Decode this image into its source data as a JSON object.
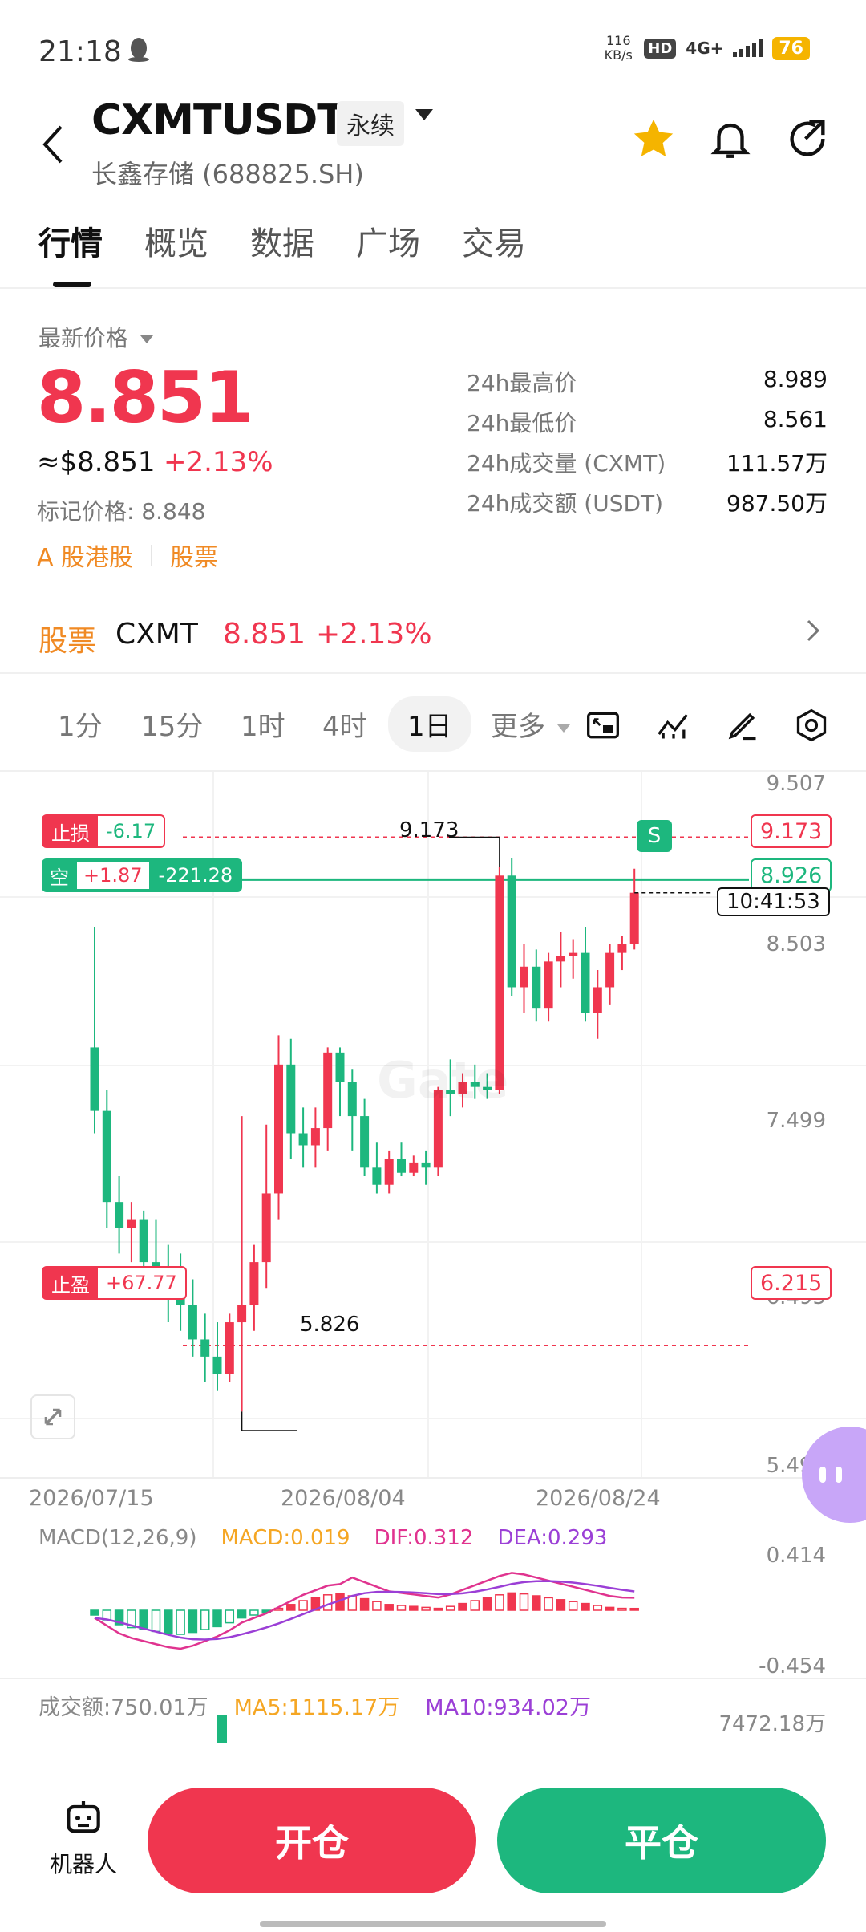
{
  "status": {
    "time": "21:18",
    "speed_top": "116",
    "speed_unit": "KB/s",
    "hd": "HD",
    "network": "4G+",
    "battery": "76"
  },
  "header": {
    "symbol": "CXMTUSDT",
    "contract": "永续",
    "subtitle": "长鑫存储 (688825.SH)"
  },
  "tabs": [
    "行情",
    "概览",
    "数据",
    "广场",
    "交易"
  ],
  "price": {
    "latest_label": "最新价格",
    "last": "8.851",
    "usd": "≈$8.851",
    "change_pct": "+2.13%",
    "mark_label": "标记价格: 8.848",
    "tag1": "A 股港股",
    "tag2": "股票",
    "stats": [
      {
        "label": "24h最高价",
        "value": "8.989"
      },
      {
        "label": "24h最低价",
        "value": "8.561"
      },
      {
        "label": "24h成交量 (CXMT)",
        "value": "111.57万"
      },
      {
        "label": "24h成交额 (USDT)",
        "value": "987.50万"
      }
    ]
  },
  "ticker": {
    "category": "股票",
    "name": "CXMT",
    "price": "8.851",
    "change": "+2.13%"
  },
  "intervals": [
    "1分",
    "15分",
    "1时",
    "4时",
    "1日",
    "更多"
  ],
  "chart": {
    "y_ticks": [
      "9.507",
      "8.503",
      "7.499",
      "6.495",
      "5.491"
    ],
    "x_ticks": [
      "2026/07/15",
      "2026/08/04",
      "2026/08/24"
    ],
    "stop_loss": {
      "label": "止损",
      "value": "-6.17",
      "price": "9.173"
    },
    "position": {
      "label": "空",
      "pnl": "+1.87",
      "amount": "-221.28",
      "price": "8.926"
    },
    "take_profit": {
      "label": "止盈",
      "value": "+67.77",
      "price": "6.215"
    },
    "high_mark": "9.173",
    "low_mark": "5.826",
    "countdown": "10:41:53",
    "signal": "S",
    "watermark": "Gate",
    "macd": {
      "title": "MACD(12,26,9)",
      "macd": "MACD:0.019",
      "dif": "DIF:0.312",
      "dea": "DEA:0.293",
      "top": "0.414",
      "bottom": "-0.454"
    },
    "volume": {
      "label": "成交额:750.01万",
      "ma5": "MA5:1115.17万",
      "ma10": "MA10:934.02万",
      "max": "7472.18万"
    },
    "colors": {
      "up": "#f0364f",
      "down": "#1db77e",
      "macd": "#f5a623",
      "dif": "#e0338f",
      "dea": "#9b3fd6"
    }
  },
  "chart_data": {
    "type": "candlestick",
    "y_range": [
      5.491,
      9.507
    ],
    "candles": [
      [
        7.95,
        8.65,
        7.45,
        7.58
      ],
      [
        7.58,
        7.7,
        6.9,
        7.05
      ],
      [
        7.05,
        7.2,
        6.75,
        6.9
      ],
      [
        6.9,
        7.05,
        6.7,
        6.95
      ],
      [
        6.95,
        7.0,
        6.6,
        6.7
      ],
      [
        6.7,
        6.95,
        6.5,
        6.55
      ],
      [
        6.55,
        6.8,
        6.35,
        6.5
      ],
      [
        6.5,
        6.75,
        6.3,
        6.45
      ],
      [
        6.45,
        6.6,
        6.15,
        6.25
      ],
      [
        6.25,
        6.4,
        6.0,
        6.15
      ],
      [
        6.15,
        6.35,
        5.95,
        6.05
      ],
      [
        6.05,
        6.4,
        6.0,
        6.35
      ],
      [
        6.35,
        7.55,
        5.83,
        6.45
      ],
      [
        6.45,
        6.8,
        6.3,
        6.7
      ],
      [
        6.7,
        7.5,
        6.55,
        7.1
      ],
      [
        7.1,
        8.02,
        6.95,
        7.85
      ],
      [
        7.85,
        8.0,
        7.3,
        7.45
      ],
      [
        7.45,
        7.6,
        7.25,
        7.38
      ],
      [
        7.38,
        7.6,
        7.25,
        7.48
      ],
      [
        7.48,
        7.95,
        7.35,
        7.92
      ],
      [
        7.92,
        7.95,
        7.55,
        7.75
      ],
      [
        7.75,
        7.82,
        7.35,
        7.55
      ],
      [
        7.55,
        7.65,
        7.2,
        7.25
      ],
      [
        7.25,
        7.4,
        7.1,
        7.15
      ],
      [
        7.15,
        7.35,
        7.1,
        7.3
      ],
      [
        7.3,
        7.4,
        7.2,
        7.22
      ],
      [
        7.22,
        7.32,
        7.2,
        7.28
      ],
      [
        7.28,
        7.35,
        7.15,
        7.25
      ],
      [
        7.25,
        7.72,
        7.2,
        7.7
      ],
      [
        7.7,
        7.88,
        7.55,
        7.68
      ],
      [
        7.68,
        7.8,
        7.6,
        7.75
      ],
      [
        7.75,
        7.85,
        7.65,
        7.72
      ],
      [
        7.72,
        7.8,
        7.65,
        7.7
      ],
      [
        7.7,
        9.0,
        7.68,
        8.95
      ],
      [
        8.95,
        9.05,
        8.25,
        8.3
      ],
      [
        8.3,
        8.55,
        8.15,
        8.42
      ],
      [
        8.42,
        8.52,
        8.1,
        8.18
      ],
      [
        8.18,
        8.5,
        8.1,
        8.45
      ],
      [
        8.45,
        8.62,
        8.3,
        8.48
      ],
      [
        8.48,
        8.58,
        8.35,
        8.5
      ],
      [
        8.5,
        8.65,
        8.1,
        8.15
      ],
      [
        8.15,
        8.4,
        8.0,
        8.3
      ],
      [
        8.3,
        8.55,
        8.2,
        8.5
      ],
      [
        8.5,
        8.6,
        8.4,
        8.55
      ],
      [
        8.55,
        8.99,
        8.52,
        8.85
      ]
    ],
    "macd_hist": [
      -0.05,
      -0.1,
      -0.15,
      -0.18,
      -0.2,
      -0.22,
      -0.24,
      -0.25,
      -0.23,
      -0.2,
      -0.17,
      -0.13,
      -0.08,
      -0.05,
      -0.02,
      0.02,
      0.06,
      0.1,
      0.13,
      0.16,
      0.17,
      0.15,
      0.12,
      0.09,
      0.06,
      0.05,
      0.04,
      0.03,
      0.02,
      0.04,
      0.07,
      0.1,
      0.13,
      0.16,
      0.18,
      0.17,
      0.15,
      0.13,
      0.11,
      0.09,
      0.07,
      0.05,
      0.03,
      0.02,
      0.019
    ],
    "volume": [
      750.01
    ]
  }
}
